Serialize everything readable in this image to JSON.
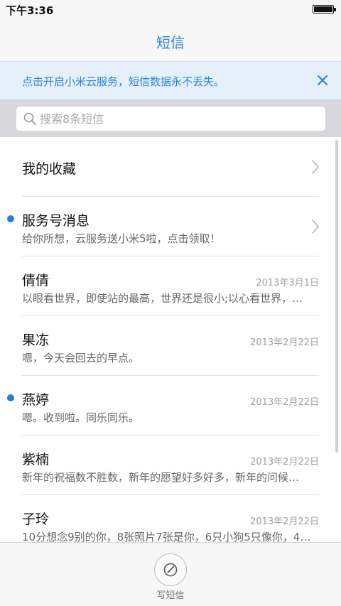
{
  "status_bar": {
    "time": "下午3:36"
  },
  "nav": {
    "title": "短信"
  },
  "notice": {
    "text": "点击开启小米云服务，短信数据永不丢失。"
  },
  "search": {
    "placeholder": "搜索8条短信"
  },
  "list": {
    "favorites": {
      "label": "我的收藏"
    },
    "service": {
      "title": "服务号消息",
      "preview": "给你所想，云服务送小米5啦，点击领取！",
      "unread": true
    },
    "conversations": [
      {
        "name": "倩倩",
        "date": "2013年3月1日",
        "preview": "以眼看世界，即使站的最高，世界还是很小;以心看世界，…",
        "unread": false
      },
      {
        "name": "果冻",
        "date": "2013年2月22日",
        "preview": "嗯，今天会回去的早点。",
        "unread": false
      },
      {
        "name": "燕婷",
        "date": "2013年2月22日",
        "preview": "嗯。收到啦。同乐同乐。",
        "unread": true
      },
      {
        "name": "紫楠",
        "date": "2013年2月22日",
        "preview": "新年的祝福数不胜数，新年的愿望好多好多，新年的问候…",
        "unread": false
      },
      {
        "name": "子玲",
        "date": "2013年2月22日",
        "preview": "10分想念9别的你，8张照片7张是你，6只小狗5只像你，4…",
        "unread": false
      }
    ]
  },
  "bottom": {
    "compose_label": "写短信"
  },
  "colors": {
    "accent": "#2a85e0",
    "unread_dot": "#1f7de6",
    "notice_bg": "#e5f0fb"
  },
  "icons": {
    "close": "close-icon",
    "search": "search-icon",
    "chevron": "chevron-right-icon",
    "compose": "compose-icon"
  }
}
